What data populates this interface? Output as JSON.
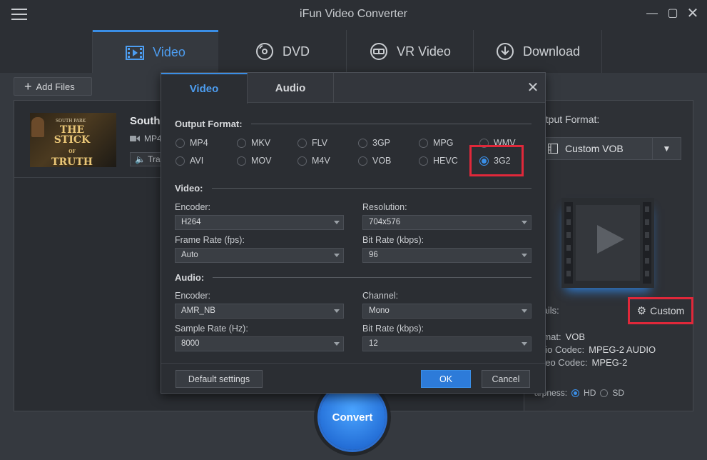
{
  "app": {
    "title": "iFun Video Converter"
  },
  "main_tabs": [
    {
      "label": "Video"
    },
    {
      "label": "DVD"
    },
    {
      "label": "VR Video"
    },
    {
      "label": "Download"
    }
  ],
  "toolbar": {
    "add_files_label": "Add Files"
  },
  "file": {
    "name": "South",
    "format": "MP4",
    "track": "Track"
  },
  "right_panel": {
    "output_format_label": "utput Format:",
    "output_format_value": "Custom VOB",
    "details_label": "tails:",
    "custom_label": "Custom",
    "info": [
      {
        "label": "rmat:",
        "value": "VOB"
      },
      {
        "label": "dio Codec:",
        "value": "MPEG-2 AUDIO"
      },
      {
        "label": "deo Codec:",
        "value": "MPEG-2"
      }
    ],
    "sharpness_label": "arpness:",
    "sharpness_options": [
      "HD",
      "SD"
    ],
    "sharpness_selected": "HD"
  },
  "convert_label": "Convert",
  "dialog": {
    "tabs": [
      "Video",
      "Audio"
    ],
    "output_format_title": "Output Format:",
    "formats_row1": [
      "MP4",
      "MKV",
      "FLV",
      "3GP",
      "MPG",
      "WMV"
    ],
    "formats_row2": [
      "AVI",
      "MOV",
      "M4V",
      "VOB",
      "HEVC",
      "3G2"
    ],
    "selected_format": "3G2",
    "video_title": "Video:",
    "video": {
      "encoder_label": "Encoder:",
      "encoder_value": "H264",
      "resolution_label": "Resolution:",
      "resolution_value": "704x576",
      "framerate_label": "Frame Rate (fps):",
      "framerate_value": "Auto",
      "bitrate_label": "Bit Rate (kbps):",
      "bitrate_value": "96"
    },
    "audio_title": "Audio:",
    "audio": {
      "encoder_label": "Encoder:",
      "encoder_value": "AMR_NB",
      "channel_label": "Channel:",
      "channel_value": "Mono",
      "samplerate_label": "Sample Rate (Hz):",
      "samplerate_value": "8000",
      "bitrate_label": "Bit Rate (kbps):",
      "bitrate_value": "12"
    },
    "default_settings_label": "Default settings",
    "ok_label": "OK",
    "cancel_label": "Cancel"
  },
  "thumbnail": {
    "line1": "SOUTH PARK",
    "line2": "THE STICK",
    "line3": "OF",
    "line4": "TRUTH"
  },
  "colors": {
    "accent": "#3a8ee6",
    "highlight_box": "#e0283a",
    "background": "#35393f"
  }
}
